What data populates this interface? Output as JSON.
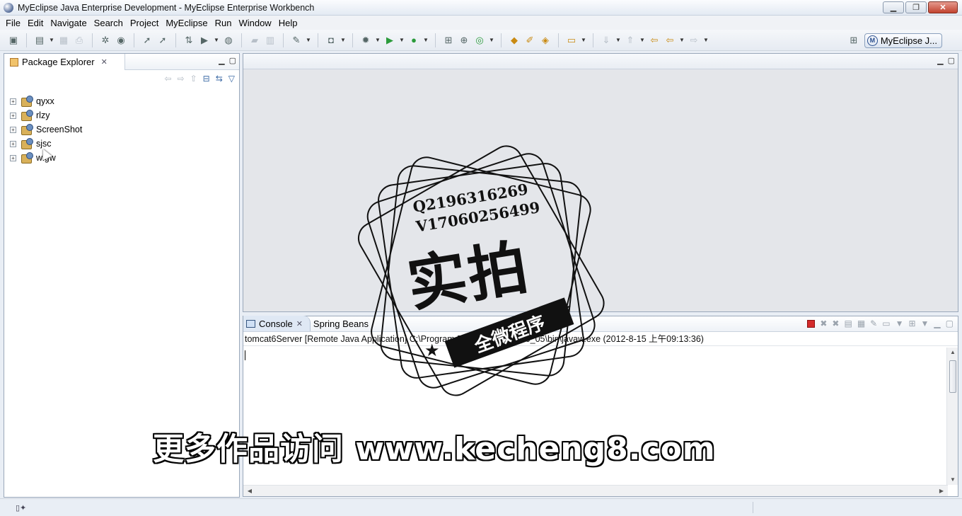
{
  "window": {
    "title": "MyEclipse Java Enterprise Development - MyEclipse Enterprise Workbench",
    "minimize": "▁",
    "restore": "❐",
    "close": "✕"
  },
  "menubar": {
    "items": [
      "File",
      "Edit",
      "Navigate",
      "Search",
      "Project",
      "MyEclipse",
      "Run",
      "Window",
      "Help"
    ]
  },
  "toolbar": {
    "perspective_label": "MyEclipse J...",
    "perspective_icon": "M"
  },
  "package_explorer": {
    "title": "Package Explorer",
    "projects": [
      {
        "name": "qyxx"
      },
      {
        "name": "rlzy"
      },
      {
        "name": "ScreenShot"
      },
      {
        "name": "sjsc"
      },
      {
        "name": "wlgw"
      }
    ]
  },
  "console": {
    "tabs": [
      {
        "label": "Console",
        "active": true
      },
      {
        "label": "Spring Beans",
        "active": false
      }
    ],
    "info_line": "tomcat6Server [Remote Java Application] C:\\Program Files\\Java\\jdk1.6.0_05\\bin\\javaw.exe (2012-8-15 上午09:13:36)"
  },
  "watermark": {
    "contact_q": "Q2196316269",
    "contact_v": "V17060256499",
    "stamp_big": "实拍",
    "stamp_banner": "全微程序",
    "subtitle": "更多作品访问 www.kecheng8.com"
  },
  "colors": {
    "stop_button": "#d32b2b",
    "active_tab": "#dfe8f4"
  }
}
